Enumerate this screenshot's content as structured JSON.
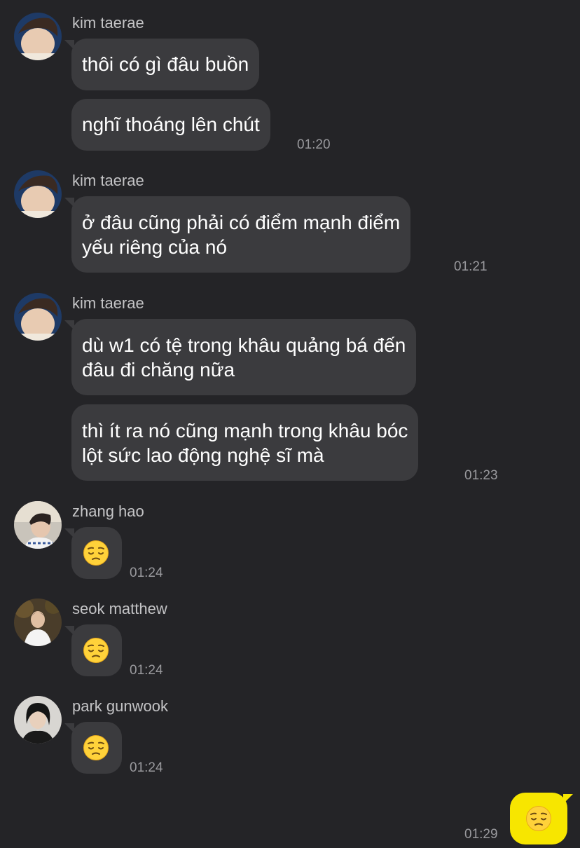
{
  "messages": [
    {
      "sender": "kim taerae",
      "avatar": "avatar-kim-taerae",
      "lines": [
        "thôi có gì đâu buồn"
      ]
    },
    {
      "sender": "kim taerae",
      "lines": [
        "nghĩ thoáng lên chút"
      ],
      "time": "01:20"
    },
    {
      "sender": "kim taerae",
      "avatar": "avatar-kim-taerae",
      "lines": [
        "ở đâu cũng phải có điểm mạnh điểm",
        "yếu riêng của nó"
      ],
      "time": "01:21"
    },
    {
      "sender": "kim taerae",
      "avatar": "avatar-kim-taerae",
      "lines": [
        "dù w1 có tệ trong khâu quảng bá đến",
        "đâu đi chăng nữa"
      ]
    },
    {
      "sender": "kim taerae",
      "lines": [
        "thì ít ra nó cũng mạnh trong khâu bóc",
        "lột sức lao động nghệ sĩ mà"
      ],
      "time": "01:23"
    },
    {
      "sender": "zhang hao",
      "avatar": "avatar-zhang-hao",
      "emoji": "pensive-face-emoji",
      "time": "01:24"
    },
    {
      "sender": "seok matthew",
      "avatar": "avatar-seok-matthew",
      "emoji": "pensive-face-emoji",
      "time": "01:24"
    },
    {
      "sender": "park gunwook",
      "avatar": "avatar-park-gunwook",
      "emoji": "pensive-face-emoji",
      "time": "01:24"
    }
  ],
  "own_message": {
    "emoji": "pensive-face-emoji",
    "time": "01:29"
  },
  "colors": {
    "background": "#242427",
    "bubble": "#3b3b3e",
    "own_bubble": "#f7e600",
    "name": "#c4c4c6",
    "time": "#9a9a9e"
  }
}
